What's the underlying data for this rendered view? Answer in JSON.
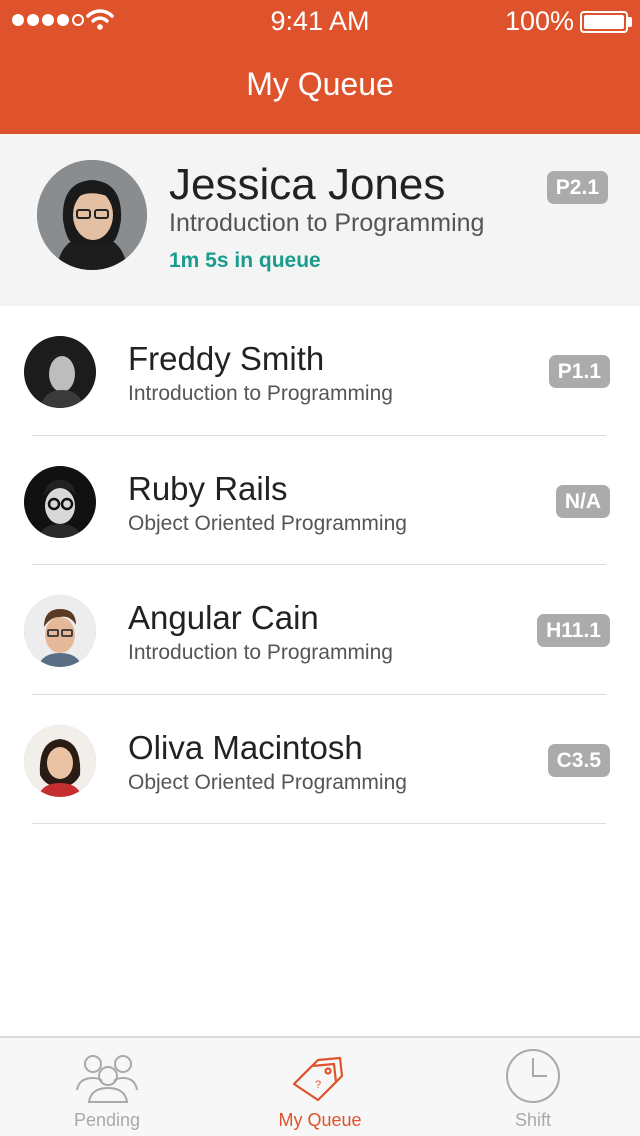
{
  "status_bar": {
    "time": "9:41 AM",
    "battery": "100%"
  },
  "nav": {
    "title": "My Queue"
  },
  "current": {
    "name": "Jessica Jones",
    "course": "Introduction to Programming",
    "wait": "1m 5s in queue",
    "location": "P2.1"
  },
  "queue": [
    {
      "name": "Freddy Smith",
      "course": "Introduction to Programming",
      "location": "P1.1"
    },
    {
      "name": "Ruby Rails",
      "course": "Object Oriented Programming",
      "location": "N/A"
    },
    {
      "name": "Angular Cain",
      "course": "Introduction to Programming",
      "location": "H11.1"
    },
    {
      "name": "Oliva Macintosh",
      "course": "Object Oriented Programming",
      "location": "C3.5"
    }
  ],
  "tabs": [
    {
      "label": "Pending",
      "icon": "people-group-icon"
    },
    {
      "label": "My Queue",
      "icon": "ticket-tags-icon"
    },
    {
      "label": "Shift",
      "icon": "clock-icon"
    }
  ],
  "colors": {
    "brand": "#DE532C",
    "wait_text": "#1A9C8C",
    "badge": "#ABABAB"
  }
}
